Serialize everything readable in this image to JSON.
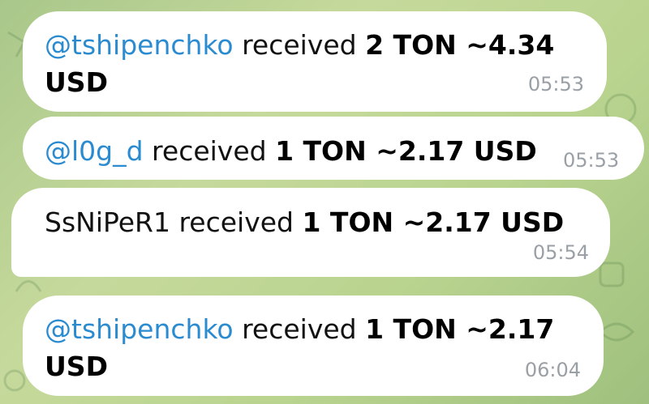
{
  "messages": [
    {
      "user": "@tshipenchko",
      "verb": " received ",
      "amount_line1": "2 TON ~4.34",
      "amount_line2": "USD",
      "time": "05:53"
    },
    {
      "user": "@l0g_d",
      "verb": " received ",
      "amount": "1 TON ~2.17 USD",
      "time": "05:53"
    },
    {
      "user": "SsNiPeR1",
      "verb": "  received ",
      "amount": "1 TON ~2.17 USD",
      "time": "05:54"
    },
    {
      "user": "@tshipenchko",
      "verb": " received ",
      "amount_line1": "1 TON ~2.17",
      "amount_line2": "USD",
      "time": "06:04"
    }
  ],
  "colors": {
    "username": "#2b8bd0",
    "timestamp": "#9aa0a6",
    "bubble": "#ffffff",
    "background": "#b9d48f"
  }
}
